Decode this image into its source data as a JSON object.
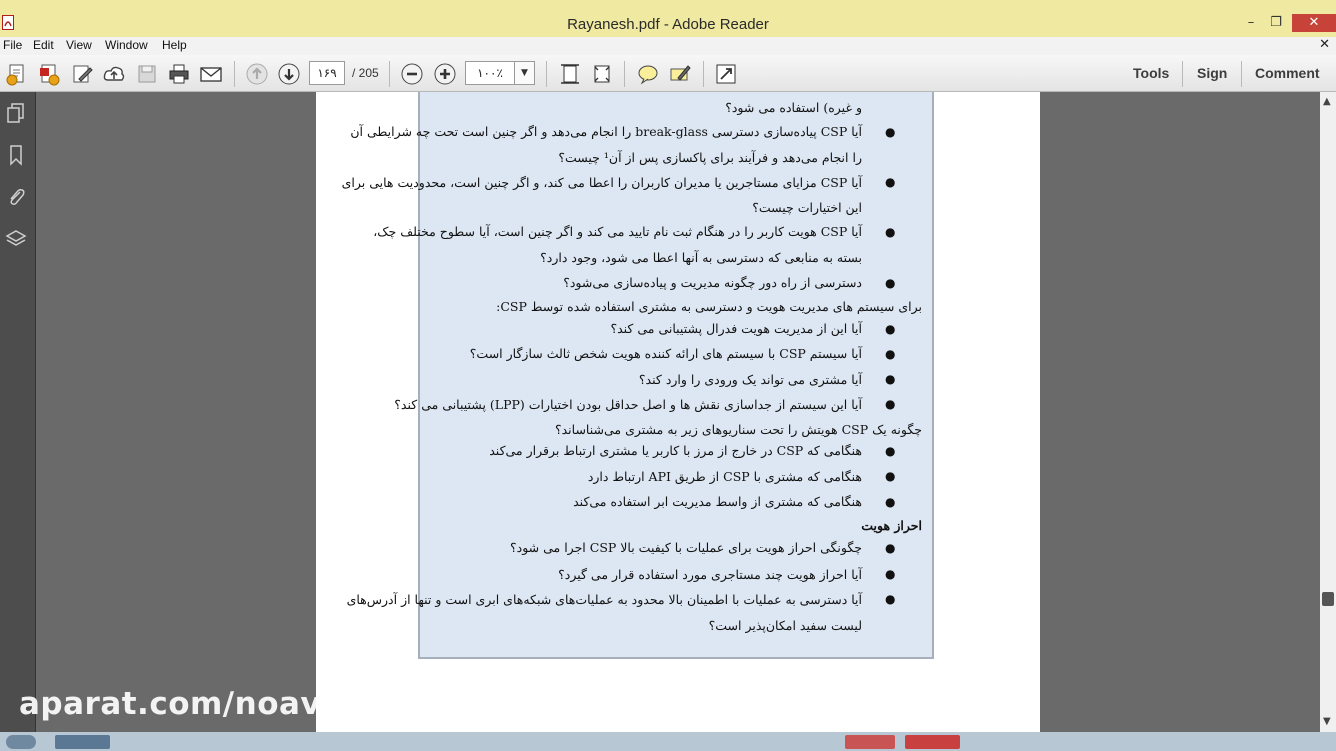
{
  "window": {
    "title": "Rayanesh.pdf - Adobe Reader"
  },
  "menu": [
    "File",
    "Edit",
    "View",
    "Window",
    "Help"
  ],
  "toolbar": {
    "page_current": "۱۶۹",
    "page_total": "/ 205",
    "zoom": "۱۰۰٪",
    "right_links": [
      "Tools",
      "Sign",
      "Comment"
    ]
  },
  "document": {
    "lines": [
      "و غیره) استفاده می شود؟",
      "آیا CSP پیاده‌سازی دسترسی break-glass را انجام می‌دهد و اگر چنین است تحت چه شرایطی آن",
      "را انجام می‌دهد و فرآیند برای پاکسازی پس از آن¹ چیست؟",
      "آیا CSP مزایای مستاجرین یا مدیران کاربران را اعطا می کند، و اگر چنین است، محدودیت هایی برای",
      "این اختیارات چیست؟",
      "آیا CSP هویت کاربر را در هنگام ثبت نام تایید می کند و اگر چنین است، آیا سطوح مختلف چک،",
      "بسته به منابعی که دسترسی به آنها اعطا می شود، وجود دارد؟",
      "دسترسی از راه دور چگونه مدیریت و پیاده‌سازی می‌شود؟",
      "برای سیستم های مدیریت هویت و دسترسی به مشتری استفاده شده توسط CSP:",
      "آیا این از مدیریت هویت فدرال پشتیبانی می کند؟",
      "آیا سیستم CSP با سیستم های ارائه کننده هویت شخص ثالث سازگار است؟",
      "آیا مشتری می تواند یک ورودی را وارد کند؟",
      "آیا این سیستم از جداسازی نقش ها و اصل حداقل بودن اختیارات (LPP) پشتیبانی می کند؟",
      "چگونه یک CSP هویتش را تحت سناریوهای زیر به مشتری می‌شناساند؟",
      "هنگامی که CSP در خارج از مرز با کاربر یا مشتری ارتباط برقرار می‌کند",
      "هنگامی که مشتری با CSP از طریق API ارتباط دارد",
      "هنگامی که مشتری از واسط مدیریت ابر استفاده می‌کند",
      "احراز هویت",
      "چگونگی احراز هویت برای عملیات با کیفیت بالا CSP اجرا می شود؟",
      "آیا احراز هویت چند مستاجری مورد استفاده قرار می گیرد؟",
      "آیا دسترسی به عملیات با اطمینان بالا محدود به عملیات‌های شبکه‌های ابری است و تنها از آدرس‌های",
      "لیست سفید امکان‌پذیر است؟"
    ]
  },
  "watermark": "aparat.com/noava"
}
